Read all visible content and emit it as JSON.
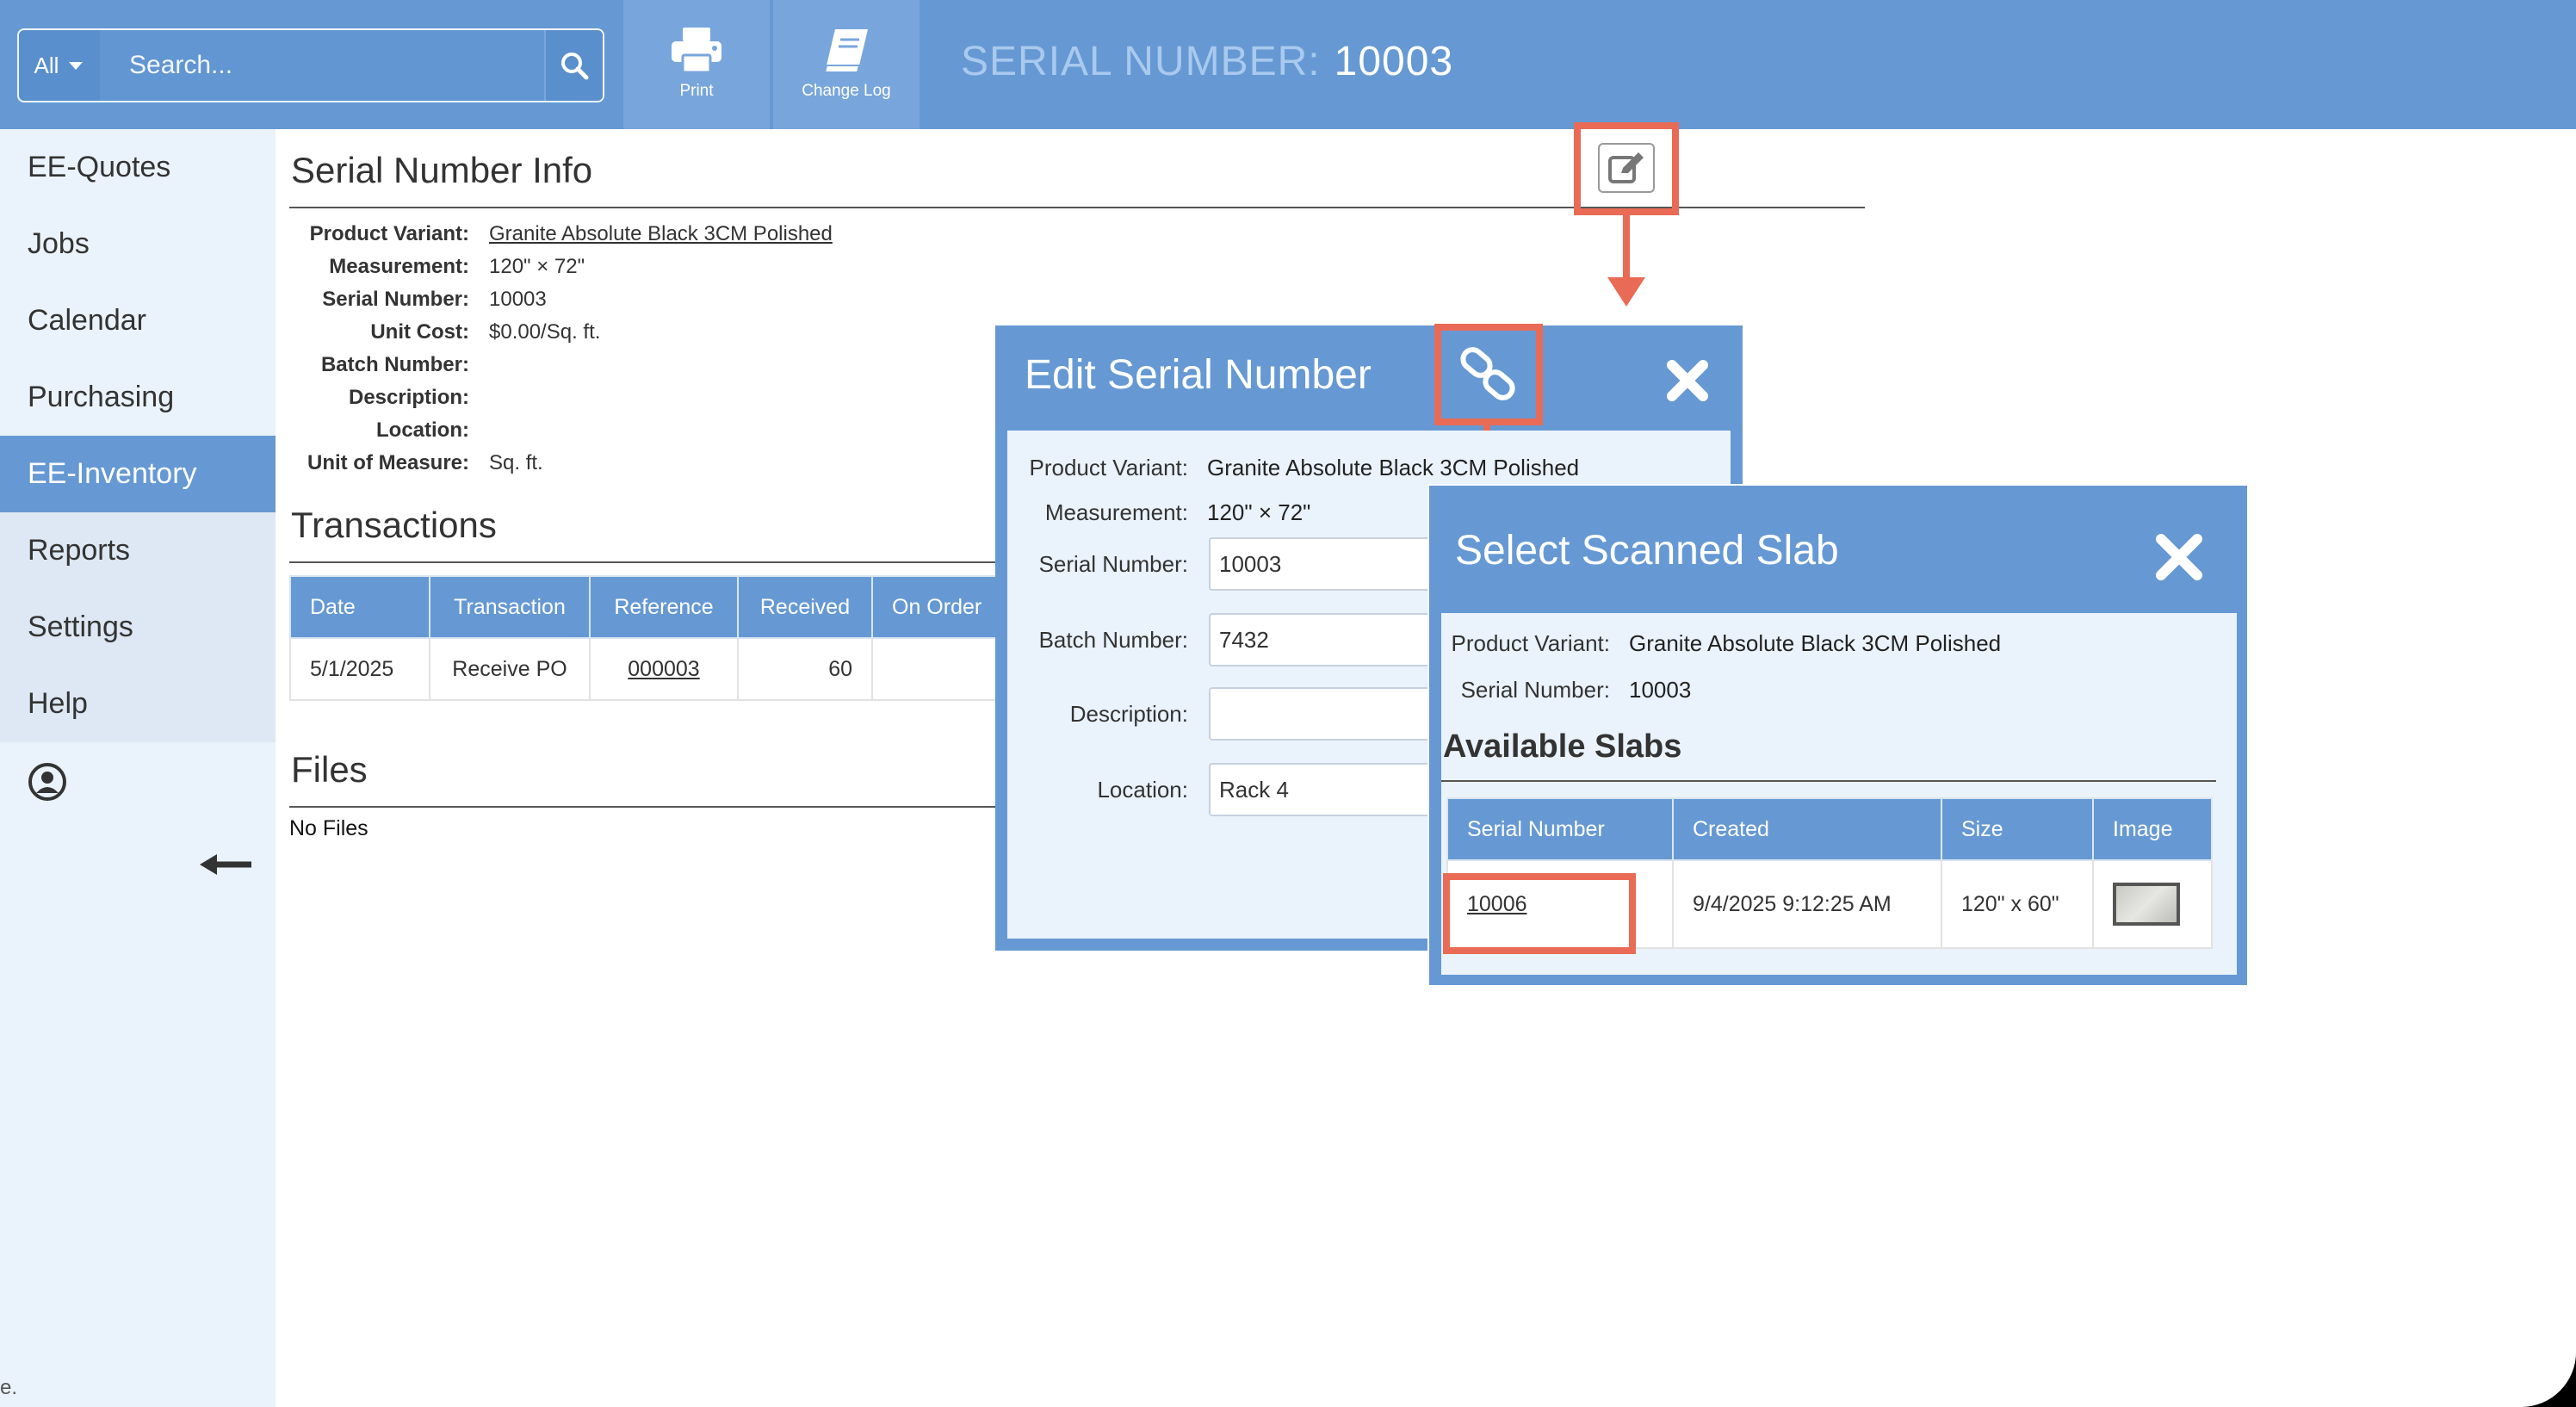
{
  "search": {
    "scope": "All",
    "placeholder": "Search..."
  },
  "toolbar": {
    "print_label": "Print",
    "changelog_label": "Change Log"
  },
  "header": {
    "label": "SERIAL NUMBER:",
    "value": "10003"
  },
  "sidebar": {
    "items": [
      {
        "label": "EE-Quotes"
      },
      {
        "label": "Jobs"
      },
      {
        "label": "Calendar"
      },
      {
        "label": "Purchasing"
      },
      {
        "label": "EE-Inventory"
      },
      {
        "label": "Reports"
      },
      {
        "label": "Settings"
      },
      {
        "label": "Help"
      }
    ]
  },
  "info": {
    "title": "Serial Number Info",
    "product_variant_label": "Product Variant:",
    "product_variant": "Granite Absolute Black 3CM Polished",
    "measurement_label": "Measurement:",
    "measurement": "120\" × 72\"",
    "serial_label": "Serial Number:",
    "serial": "10003",
    "unit_cost_label": "Unit Cost:",
    "unit_cost": "$0.00/Sq. ft.",
    "batch_label": "Batch Number:",
    "description_label": "Description:",
    "location_label": "Location:",
    "uom_label": "Unit of Measure:",
    "uom": "Sq. ft."
  },
  "transactions": {
    "title": "Transactions",
    "headers": [
      "Date",
      "Transaction",
      "Reference",
      "Received",
      "On Order"
    ],
    "rows": [
      {
        "date": "5/1/2025",
        "transaction": "Receive PO",
        "reference": "000003",
        "received": "60",
        "on_order": ""
      }
    ]
  },
  "files": {
    "title": "Files",
    "empty": "No Files"
  },
  "edit_modal": {
    "title": "Edit Serial Number",
    "product_variant_label": "Product Variant:",
    "product_variant": "Granite Absolute Black 3CM Polished",
    "measurement_label": "Measurement:",
    "measurement": "120\" × 72\"",
    "serial_label": "Serial Number:",
    "serial": "10003",
    "batch_label": "Batch Number:",
    "batch": "7432",
    "description_label": "Description:",
    "description": "",
    "location_label": "Location:",
    "location": "Rack 4"
  },
  "slab_modal": {
    "title": "Select Scanned Slab",
    "product_variant_label": "Product Variant:",
    "product_variant": "Granite Absolute Black 3CM Polished",
    "serial_label": "Serial Number:",
    "serial": "10003",
    "section_title": "Available Slabs",
    "headers": [
      "Serial Number",
      "Created",
      "Size",
      "Image"
    ],
    "rows": [
      {
        "serial": "10006",
        "created": "9/4/2025 9:12:25 AM",
        "size": "120\" x 60\""
      }
    ]
  },
  "footer": {
    "text": "e."
  },
  "colors": {
    "accent": "#6699d3",
    "highlight": "#e96b56",
    "background": "#eaf3fb"
  }
}
